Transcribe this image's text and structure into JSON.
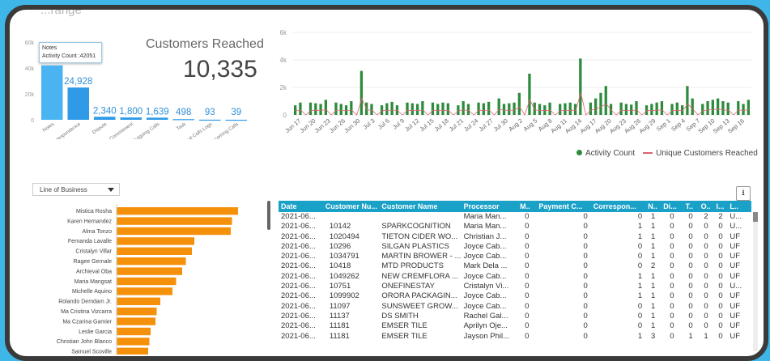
{
  "title": "...range",
  "tooltip": {
    "line1": "Notes",
    "line2": "Activity Count :42051"
  },
  "customers_reached": {
    "title": "Customers Reached",
    "value": "10,335"
  },
  "chart_data": [
    {
      "type": "bar",
      "categories": [
        "Notes",
        "Correspondence",
        "Dispute",
        "Payment Commitment",
        "Outgoing Calls",
        "Task",
        "Manual Calls Logs",
        "Incoming Calls"
      ],
      "values": [
        42051,
        24928,
        2340,
        1800,
        1639,
        498,
        93,
        39
      ],
      "labels": [
        "",
        "24,928",
        "2,340",
        "1,800",
        "1,639",
        "498",
        "93",
        "39"
      ],
      "yticks": [
        "0",
        "20k",
        "40k",
        "60k"
      ],
      "ylim": [
        0,
        60000
      ],
      "color": "#2f9ae8"
    },
    {
      "type": "line",
      "yticks": [
        "0",
        "2k",
        "4k",
        "6k"
      ],
      "ylim": [
        0,
        6000
      ],
      "xticks": [
        "Jun 17",
        "Jun 20",
        "Jun 23",
        "Jun 26",
        "Jun 30",
        "Jul 3",
        "Jul 6",
        "Jul 9",
        "Jul 12",
        "Jul 15",
        "Jul 18",
        "Jul 21",
        "Jul 24",
        "Jul 27",
        "Jul 30",
        "Aug 2",
        "Aug 5",
        "Aug 8",
        "Aug 11",
        "Aug 14",
        "Aug 17",
        "Aug 20",
        "Aug 23",
        "Aug 26",
        "Aug 29",
        "Sep 1",
        "Sep 4",
        "Sep 7",
        "Sep 10",
        "Sep 13",
        "Sep 16"
      ],
      "series": [
        {
          "name": "Activity Count",
          "color": "#2e8b3d",
          "values": [
            700,
            900,
            0,
            900,
            850,
            800,
            1100,
            0,
            900,
            800,
            700,
            1000,
            0,
            3200,
            900,
            800,
            0,
            700,
            850,
            950,
            700,
            0,
            900,
            850,
            800,
            1000,
            0,
            900,
            800,
            900,
            850,
            0,
            700,
            1000,
            800,
            0,
            900,
            850,
            950,
            0,
            1200,
            800,
            850,
            900,
            1600,
            0,
            3000,
            900,
            800,
            700,
            900,
            0,
            800,
            850,
            900,
            800,
            4100,
            0,
            900,
            1200,
            1600,
            2100,
            800,
            0,
            900,
            800,
            750,
            1000,
            0,
            700,
            800,
            900,
            1000,
            0,
            800,
            900,
            700,
            2100,
            1200,
            0,
            800,
            1000,
            1100,
            1200,
            1000,
            900,
            0,
            1000,
            800,
            1100
          ]
        },
        {
          "name": "Unique Customers Reached",
          "color": "#e06070",
          "values": [
            300,
            350,
            0,
            320,
            340,
            330,
            380,
            0,
            350,
            330,
            320,
            360,
            0,
            1200,
            360,
            340,
            0,
            310,
            330,
            350,
            320,
            0,
            340,
            330,
            320,
            360,
            0,
            340,
            330,
            340,
            330,
            0,
            310,
            360,
            320,
            0,
            340,
            330,
            350,
            0,
            420,
            330,
            340,
            350,
            600,
            0,
            1100,
            350,
            330,
            310,
            340,
            0,
            320,
            330,
            340,
            330,
            1600,
            0,
            350,
            430,
            600,
            800,
            330,
            0,
            340,
            330,
            320,
            360,
            0,
            310,
            320,
            340,
            360,
            0,
            320,
            340,
            310,
            800,
            430,
            0,
            320,
            360,
            390,
            430,
            360,
            340,
            0,
            360,
            320,
            400
          ]
        }
      ]
    },
    {
      "type": "bar",
      "orientation": "horizontal",
      "categories": [
        "Mistica Rosha",
        "Karen Hernandez",
        "Alma Tonzo",
        "Fernanda Lavalle",
        "Cristalyn Villar",
        "Ragee Gernale",
        "Archieval Oba",
        "Maria Mangsat",
        "Michelle Aquino",
        "Rolando Demdam Jr.",
        "Ma Cristina Vizcarra",
        "Ma Czarina Gamier",
        "Leslie Garcia",
        "Christian John Blanco",
        "Samuel Scoville"
      ],
      "values": [
        100,
        95,
        94,
        64,
        62,
        57,
        54,
        49,
        46,
        36,
        33,
        32,
        28,
        27,
        26
      ],
      "color": "#f5900a"
    }
  ],
  "line_legend": {
    "a": "Activity Count",
    "b": "Unique Customers Reached"
  },
  "filter": {
    "label": "Line of Business"
  },
  "table": {
    "headers": [
      "Date",
      "Customer Nu...",
      "Customer Name",
      "Processor",
      "M..",
      "Payment C...",
      "Correspon...",
      "N..",
      "Di...",
      "T..",
      "O..",
      "I...",
      "L.."
    ],
    "rows": [
      [
        "2021-06...",
        "",
        "",
        "Maria Man...",
        "0",
        "0",
        "0",
        "1",
        "0",
        "0",
        "2",
        "2",
        "U..."
      ],
      [
        "2021-06...",
        "10142",
        "SPARKCOGNITION",
        "Maria Man...",
        "0",
        "0",
        "1",
        "1",
        "0",
        "0",
        "0",
        "0",
        "U..."
      ],
      [
        "2021-06...",
        "1020494",
        "TIETON CIDER WO...",
        "Christian J...",
        "0",
        "0",
        "1",
        "1",
        "0",
        "0",
        "0",
        "0",
        "UF"
      ],
      [
        "2021-06...",
        "10296",
        "SILGAN PLASTICS",
        "Joyce Cab...",
        "0",
        "0",
        "0",
        "1",
        "0",
        "0",
        "0",
        "0",
        "UF"
      ],
      [
        "2021-06...",
        "1034791",
        "MARTIN BROWER - ...",
        "Joyce Cab...",
        "0",
        "0",
        "0",
        "1",
        "0",
        "0",
        "0",
        "0",
        "UF"
      ],
      [
        "2021-06...",
        "10418",
        "MTD PRODUCTS",
        "Mark Dela ...",
        "0",
        "0",
        "0",
        "2",
        "0",
        "0",
        "0",
        "0",
        "UF"
      ],
      [
        "2021-06...",
        "1049262",
        "NEW CREMFLORA ...",
        "Joyce Cab...",
        "0",
        "0",
        "1",
        "1",
        "0",
        "0",
        "0",
        "0",
        "UF"
      ],
      [
        "2021-06...",
        "10751",
        "ONEFINESTAY",
        "Cristalyn Vi...",
        "0",
        "0",
        "1",
        "1",
        "0",
        "0",
        "0",
        "0",
        "U..."
      ],
      [
        "2021-06...",
        "1099902",
        "ORORA PACKAGIN...",
        "Joyce Cab...",
        "0",
        "0",
        "1",
        "1",
        "0",
        "0",
        "0",
        "0",
        "UF"
      ],
      [
        "2021-06...",
        "11097",
        "SUNSWEET GROW...",
        "Joyce Cab...",
        "0",
        "0",
        "0",
        "1",
        "0",
        "0",
        "0",
        "0",
        "UF"
      ],
      [
        "2021-06...",
        "11137",
        "DS SMITH",
        "Rachel Gal...",
        "0",
        "0",
        "0",
        "1",
        "0",
        "0",
        "0",
        "0",
        "UF"
      ],
      [
        "2021-06...",
        "11181",
        "EMSER TILE",
        "Aprilyn Oje...",
        "0",
        "0",
        "0",
        "1",
        "0",
        "0",
        "0",
        "0",
        "UF"
      ],
      [
        "2021-06...",
        "11181",
        "EMSER TILE",
        "Jayson Phil...",
        "0",
        "0",
        "1",
        "3",
        "0",
        "1",
        "1",
        "0",
        "UF"
      ]
    ]
  },
  "download_icon": "download-icon"
}
